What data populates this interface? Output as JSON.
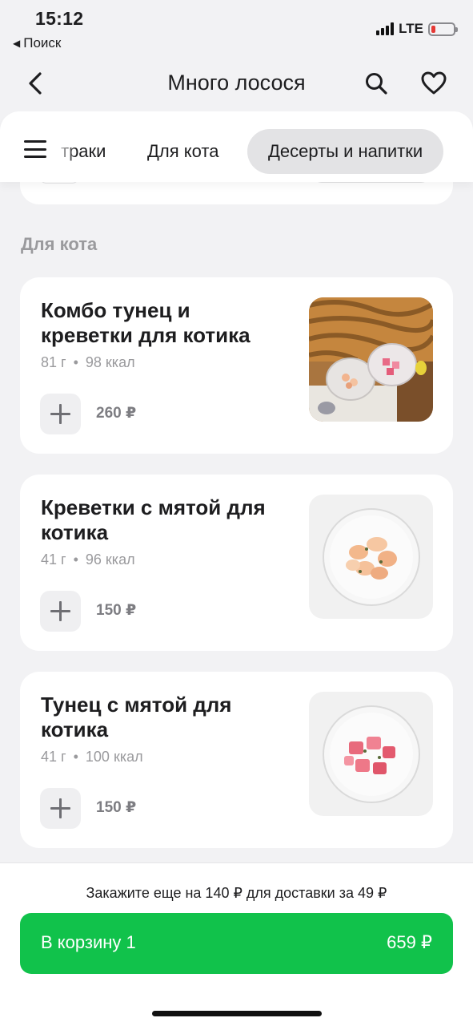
{
  "status_bar": {
    "time": "15:12",
    "back_label": "Поиск",
    "network": "LTE"
  },
  "nav": {
    "title": "Много лосося"
  },
  "categories": {
    "tabs": [
      {
        "label": "Завтраки",
        "visible_label": "траки",
        "active": false
      },
      {
        "label": "Для кота",
        "active": false
      },
      {
        "label": "Десерты и напитки",
        "active": true
      }
    ]
  },
  "section": {
    "title": "Для кота"
  },
  "products": [
    {
      "name": "Комбо тунец и креветки для котика",
      "weight": "81 г",
      "calories": "98 ккал",
      "price": "260 ₽"
    },
    {
      "name": "Креветки с мятой для котика",
      "weight": "41 г",
      "calories": "96 ккал",
      "price": "150 ₽"
    },
    {
      "name": "Тунец с мятой для котика",
      "weight": "41 г",
      "calories": "100 ккал",
      "price": "150 ₽"
    }
  ],
  "cart": {
    "delivery_note": "Закажите еще на 140 ₽ для доставки за 49 ₽",
    "button_label": "В корзину 1",
    "total": "659 ₽"
  },
  "colors": {
    "accent_green": "#11c24b",
    "background": "#f2f2f4",
    "muted_text": "#9a9a9d",
    "battery_low": "#e53935"
  },
  "icons": {
    "back": "chevron-left-icon",
    "search": "search-icon",
    "favorite": "heart-icon",
    "menu": "hamburger-menu-icon",
    "add": "plus-icon"
  }
}
